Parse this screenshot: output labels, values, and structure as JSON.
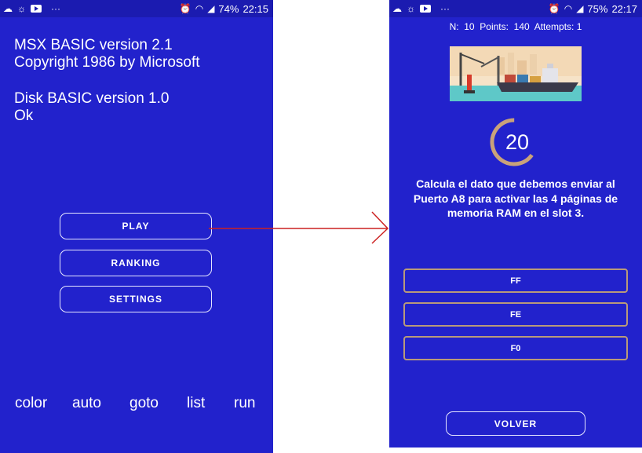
{
  "colors": {
    "screen_bg": "#2222cc",
    "accent_timer": "#c9a27a",
    "arrow": "#cc2222",
    "answer_border": "#b99a7a"
  },
  "left": {
    "status": {
      "battery": "74%",
      "time": "22:15",
      "left_icons": [
        "cloud-icon",
        "weather-icon",
        "youtube-icon",
        "more-dots-icon"
      ],
      "right_icons": [
        "alarm-icon",
        "wifi-icon",
        "signal-icon"
      ]
    },
    "console": [
      "MSX BASIC version 2.1",
      "Copyright 1986 by Microsoft",
      "Disk BASIC version 1.0",
      "Ok"
    ],
    "buttons": {
      "play": "PLAY",
      "ranking": "RANKING",
      "settings": "SETTINGS"
    },
    "commands": [
      "color",
      "auto",
      "goto",
      "list",
      "run"
    ]
  },
  "right": {
    "status": {
      "battery": "75%",
      "time": "22:17"
    },
    "stats": {
      "n_label": "N:",
      "n_value": "10",
      "points_label": "Points:",
      "points_value": "140",
      "attempts_label": "Attempts:",
      "attempts_value": "1"
    },
    "timer": {
      "value": "20",
      "remaining_fraction": 0.65
    },
    "question": "Calcula el dato que debemos enviar al Puerto A8 para activar las 4 páginas de memoria RAM en el slot 3.",
    "answers": [
      "FF",
      "FE",
      "F0"
    ],
    "back_button": "VOLVER"
  }
}
